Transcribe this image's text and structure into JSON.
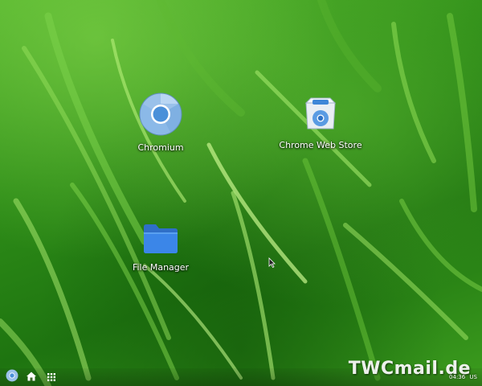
{
  "desktop": {
    "icons": [
      {
        "id": "chromium",
        "label": "Chromium",
        "icon": "chromium-icon"
      },
      {
        "id": "webstore",
        "label": "Chrome Web Store",
        "icon": "web-store-icon"
      },
      {
        "id": "files",
        "label": "File Manager",
        "icon": "folder-icon"
      }
    ]
  },
  "shelf": {
    "items": [
      {
        "id": "chromium",
        "icon": "chromium-icon"
      },
      {
        "id": "home",
        "icon": "home-icon"
      },
      {
        "id": "apps",
        "icon": "app-launcher-icon"
      }
    ]
  },
  "tray": {
    "time": "04:36",
    "locale": "US"
  },
  "watermark": {
    "text": "TWCmail.de"
  },
  "colors": {
    "folder": "#3b86e8",
    "chromium_ring": "#9ac1ea",
    "chromium_center": "#4a90d9"
  }
}
